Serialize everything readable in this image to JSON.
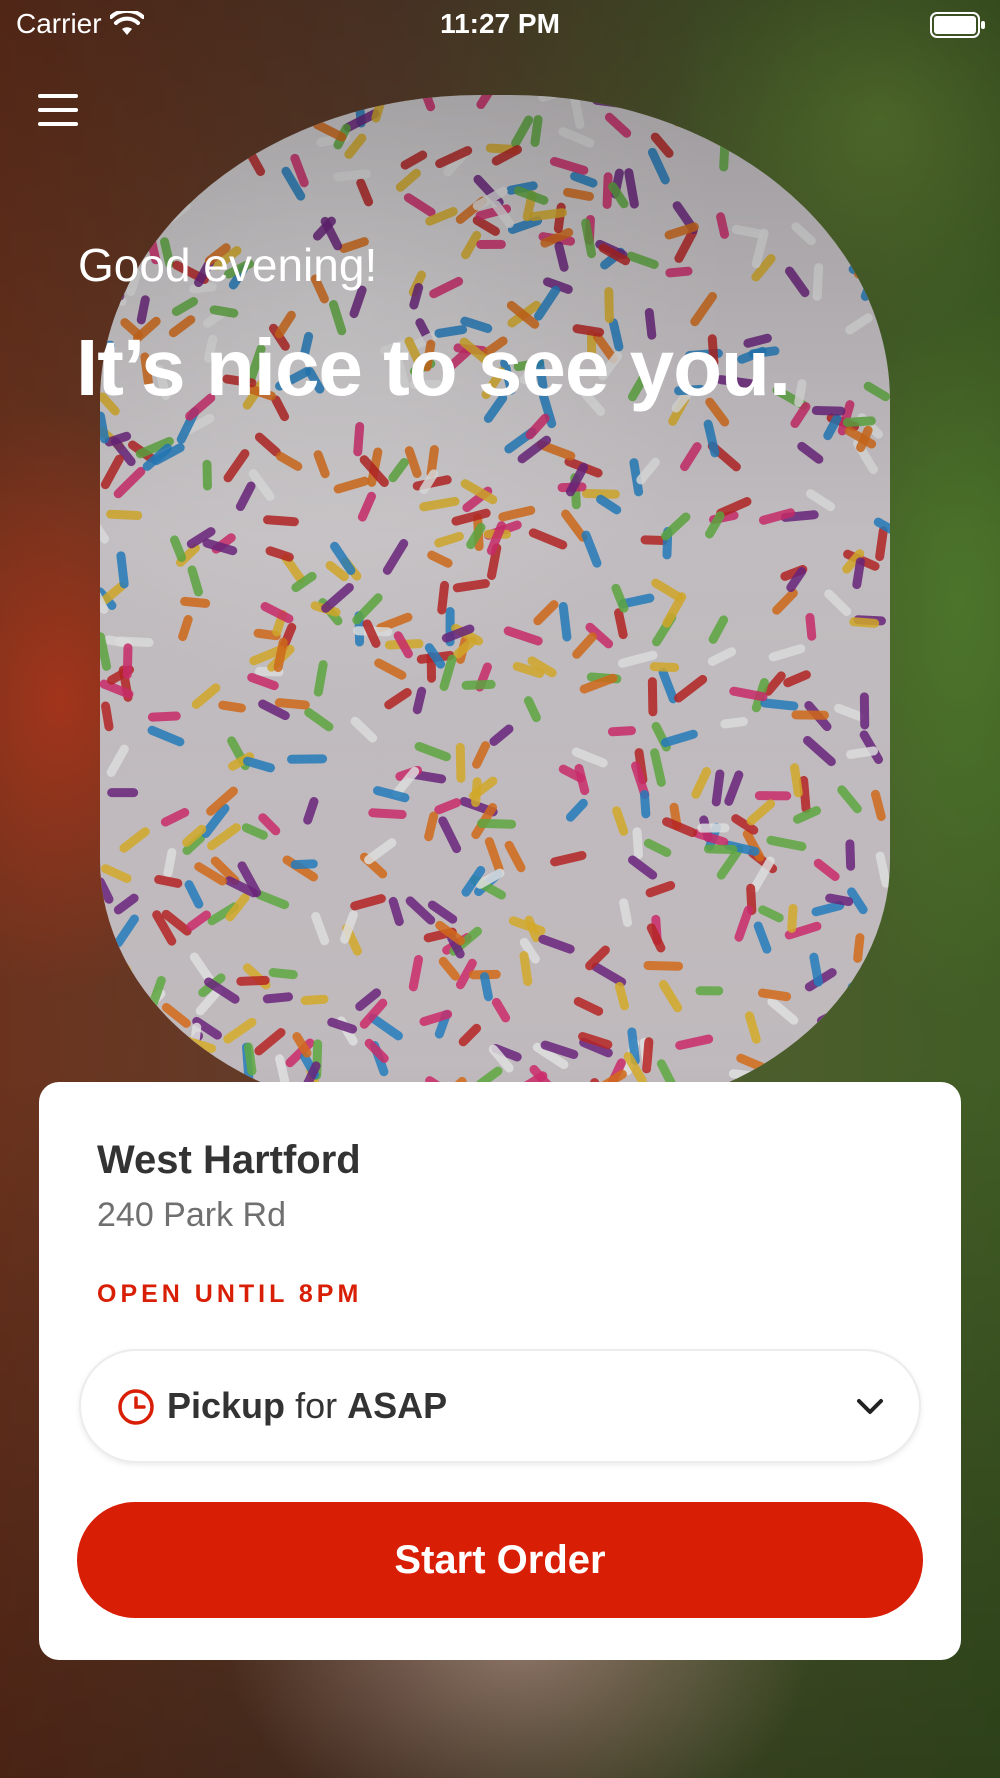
{
  "status_bar": {
    "carrier": "Carrier",
    "time": "11:27 PM"
  },
  "menu": {
    "icon": "hamburger-menu-icon"
  },
  "hero": {
    "greeting": "Good evening!",
    "headline": "It’s nice to see you."
  },
  "store": {
    "name": "West Hartford",
    "address": "240 Park Rd",
    "hours": "OPEN UNTIL 8PM"
  },
  "order_mode": {
    "icon": "clock-icon",
    "mode": "Pickup",
    "connector": "for",
    "time": "ASAP"
  },
  "actions": {
    "start_order": "Start Order"
  },
  "colors": {
    "accent": "#d81e05",
    "text_dark": "#333333",
    "text_muted": "#707070"
  }
}
